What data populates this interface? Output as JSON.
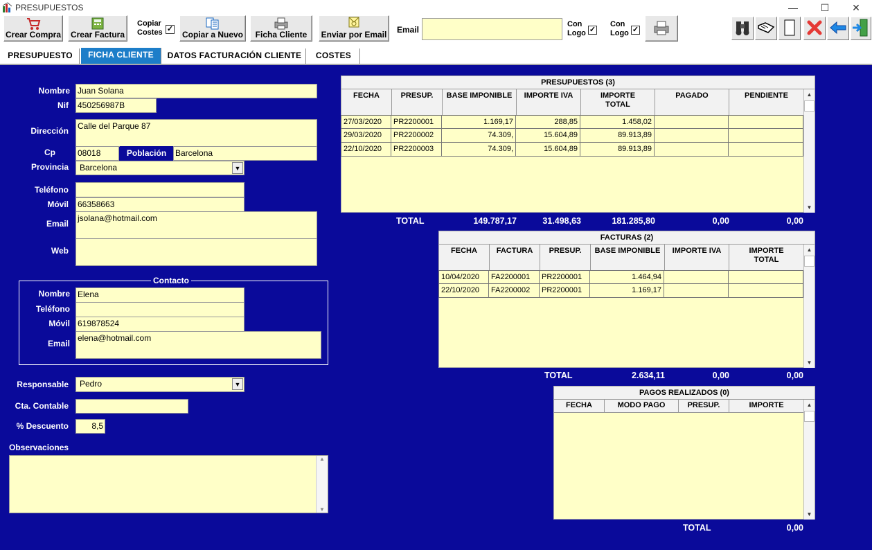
{
  "window": {
    "title": "PRESUPUESTOS",
    "minimize": "—",
    "maximize": "☐",
    "close": "✕"
  },
  "toolbar": {
    "crear_compra": "Crear Compra",
    "crear_factura": "Crear Factura",
    "copiar_costes": "Copiar Costes",
    "copiar_costes_l1": "Copiar",
    "copiar_costes_l2": "Costes",
    "copiar_a_nuevo": "Copiar a Nuevo",
    "ficha_cliente": "Ficha Cliente",
    "enviar_por_email": "Enviar por Email",
    "email_label": "Email",
    "email_value": "",
    "con_logo_l1": "Con",
    "con_logo_l2": "Logo",
    "check_mark": "✓"
  },
  "tabs": [
    {
      "label": "PRESUPUESTO"
    },
    {
      "label": "FICHA CLIENTE"
    },
    {
      "label": "DATOS FACTURACIÓN CLIENTE"
    },
    {
      "label": "COSTES"
    }
  ],
  "cliente": {
    "nombre_label": "Nombre",
    "nombre": "Juan Solana",
    "nif_label": "Nif",
    "nif": "450256987B",
    "direccion_label": "Dirección",
    "direccion": "Calle del Parque 87",
    "cp_label": "Cp",
    "cp": "08018",
    "poblacion_label": "Población",
    "poblacion": "Barcelona",
    "provincia_label": "Provincia",
    "provincia": "Barcelona",
    "telefono_label": "Teléfono",
    "telefono": "",
    "movil_label": "Móvil",
    "movil": "66358663",
    "email_label": "Email",
    "email": "jsolana@hotmail.com",
    "web_label": "Web",
    "web": ""
  },
  "contacto": {
    "legend": "Contacto",
    "nombre_label": "Nombre",
    "nombre": "Elena",
    "telefono_label": "Teléfono",
    "telefono": "",
    "movil_label": "Móvil",
    "movil": "619878524",
    "email_label": "Email",
    "email": "elena@hotmail.com"
  },
  "otros": {
    "responsable_label": "Responsable",
    "responsable": "Pedro",
    "cta_contable_label": "Cta. Contable",
    "cta_contable": "",
    "descuento_label": "% Descuento",
    "descuento": "8,5",
    "observaciones_label": "Observaciones",
    "observaciones": ""
  },
  "presupuestos": {
    "title": "PRESUPUESTOS  (3)",
    "columns": [
      "FECHA",
      "PRESUP.",
      "BASE IMPONIBLE",
      "IMPORTE IVA",
      "IMPORTE TOTAL",
      "PAGADO",
      "PENDIENTE"
    ],
    "rows": [
      [
        "27/03/2020",
        "PR2200001",
        "1.169,17",
        "288,85",
        "1.458,02",
        "",
        ""
      ],
      [
        "29/03/2020",
        "PR2200002",
        "74.309,",
        "15.604,89",
        "89.913,89",
        "",
        ""
      ],
      [
        "22/10/2020",
        "PR2200003",
        "74.309,",
        "15.604,89",
        "89.913,89",
        "",
        ""
      ]
    ],
    "total_label": "TOTAL",
    "totals": [
      "149.787,17",
      "31.498,63",
      "181.285,80",
      "0,00",
      "0,00"
    ]
  },
  "facturas": {
    "title": "FACTURAS  (2)",
    "columns": [
      "FECHA",
      "FACTURA",
      "PRESUP.",
      "BASE IMPONIBLE",
      "IMPORTE IVA",
      "IMPORTE TOTAL"
    ],
    "rows": [
      [
        "10/04/2020",
        "FA2200001",
        "PR2200001",
        "1.464,94",
        "",
        ""
      ],
      [
        "22/10/2020",
        "FA2200002",
        "PR2200001",
        "1.169,17",
        "",
        ""
      ]
    ],
    "total_label": "TOTAL",
    "totals": [
      "2.634,11",
      "0,00",
      "0,00"
    ]
  },
  "pagos": {
    "title": "PAGOS  REALIZADOS  (0)",
    "columns": [
      "FECHA",
      "MODO PAGO",
      "PRESUP.",
      "IMPORTE"
    ],
    "rows": [],
    "total_label": "TOTAL",
    "totals": [
      "0,00"
    ]
  },
  "scroll": {
    "up": "▲",
    "down": "▼",
    "dropdown": "▼"
  }
}
